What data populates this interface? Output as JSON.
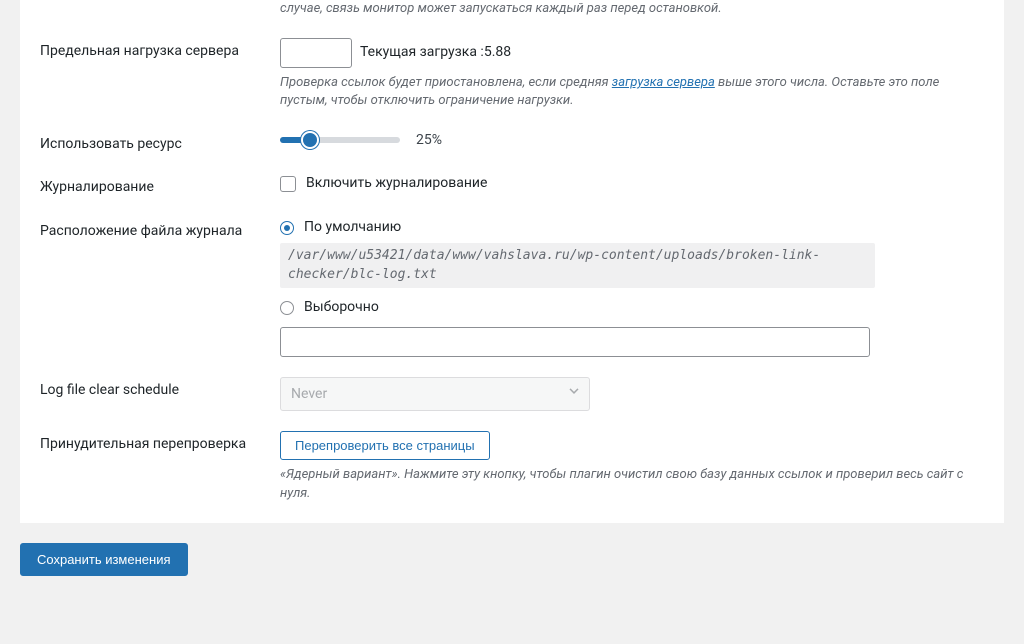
{
  "top_description": "случае, связь монитор может запускаться каждый раз перед остановкой.",
  "rows": {
    "server_load": {
      "label": "Предельная нагрузка сервера",
      "value": "",
      "current_prefix": "Текущая загрузка : ",
      "current_value": "5.88",
      "description_before": "Проверка ссылок будет приостановлена, если средняя ",
      "description_link": "загрузка сервера",
      "description_after": " выше этого числа. Оставьте это поле пустым, чтобы отключить ограничение нагрузки."
    },
    "resource": {
      "label": "Использовать ресурс",
      "percent": "25%"
    },
    "logging": {
      "label": "Журналирование",
      "checkbox_label": "Включить журналирование"
    },
    "log_location": {
      "label": "Расположение файла журнала",
      "option_default": "По умолчанию",
      "path": "/var/www/u53421/data/www/vahslava.ru/wp-content/uploads/broken-link-checker/blc-log.txt",
      "option_custom": "Выборочно",
      "custom_value": ""
    },
    "clear_schedule": {
      "label": "Log file clear schedule",
      "value": "Never"
    },
    "recheck": {
      "label": "Принудительная перепроверка",
      "button": "Перепроверить все страницы",
      "description": "«Ядерный вариант». Нажмите эту кнопку, чтобы плагин очистил свою базу данных ссылок и проверил весь сайт с нуля."
    }
  },
  "save_button": "Сохранить изменения"
}
